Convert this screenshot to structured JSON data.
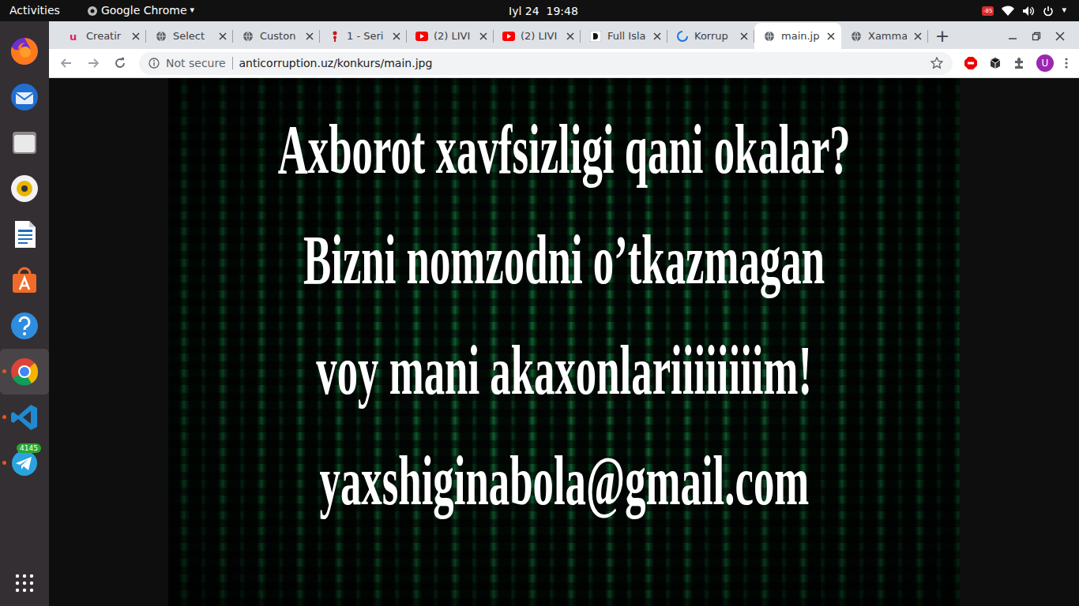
{
  "topbar": {
    "activities": "Activities",
    "app": "Google Chrome",
    "app_arrow": "▾",
    "clock": "Iyl 24  19:48",
    "indicator": "-85",
    "power_arrow": "▾"
  },
  "dock": {
    "items": [
      {
        "kind": "firefox",
        "running": false,
        "badge": ""
      },
      {
        "kind": "thunderbird",
        "running": false,
        "badge": ""
      },
      {
        "kind": "files",
        "running": false,
        "badge": ""
      },
      {
        "kind": "rhythmbox",
        "running": false,
        "badge": ""
      },
      {
        "kind": "writer",
        "running": false,
        "badge": ""
      },
      {
        "kind": "software",
        "running": false,
        "badge": ""
      },
      {
        "kind": "help",
        "running": false,
        "badge": ""
      },
      {
        "kind": "chrome",
        "running": true,
        "badge": ""
      },
      {
        "kind": "vscode",
        "running": true,
        "badge": ""
      },
      {
        "kind": "telegram",
        "running": true,
        "badge": "4145"
      }
    ]
  },
  "tabs": [
    {
      "label": "Creatir",
      "kind": "unsplash",
      "selected": false
    },
    {
      "label": "Select",
      "kind": "globe",
      "selected": false
    },
    {
      "label": "Custon",
      "kind": "globe",
      "selected": false
    },
    {
      "label": "1 - Seri",
      "kind": "pin",
      "selected": false
    },
    {
      "label": "(2) LIVI",
      "kind": "youtube",
      "selected": false
    },
    {
      "label": "(2) LIVI",
      "kind": "youtube",
      "selected": false
    },
    {
      "label": "Full Isla",
      "kind": "dev",
      "selected": false
    },
    {
      "label": "Korrup",
      "kind": "loading",
      "selected": false
    },
    {
      "label": "main.jp",
      "kind": "globe",
      "selected": true
    },
    {
      "label": "Xamma",
      "kind": "globe",
      "selected": false
    }
  ],
  "new_tab": "+",
  "address": {
    "security": "Not secure",
    "url": "anticorruption.uz/konkurs/main.jpg"
  },
  "profile": "U",
  "image": {
    "lines": [
      "Axborot xavfsizligi qani okalar?",
      "Bizni nomzodni o’tkazmagan",
      "voy mani akaxonlariiiiiiiim!",
      "yaxshiginabola@gmail.com"
    ]
  }
}
